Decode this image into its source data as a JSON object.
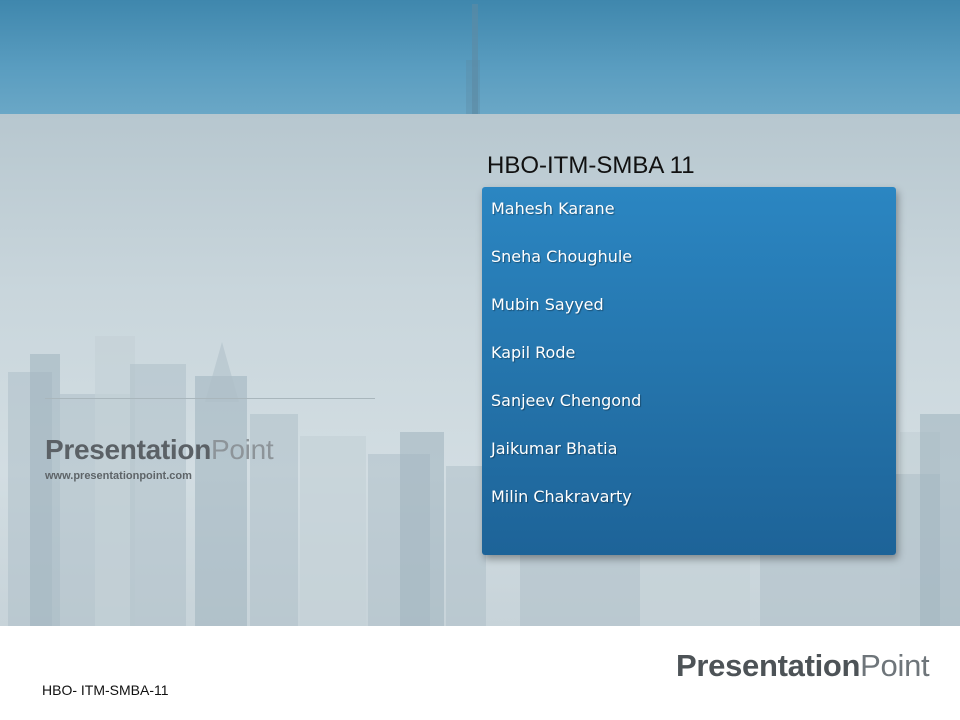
{
  "slide": {
    "heading": "HBO-ITM-SMBA 11",
    "members": [
      "Mahesh Karane",
      "Sneha Choughule",
      "Mubin Sayyed",
      "Kapil Rode",
      "Sanjeev Chengond",
      "Jaikumar Bhatia",
      "Milin Chakravarty"
    ],
    "brand": {
      "bold": "Presentation",
      "light": "Point"
    },
    "website": "www.presentationpoint.com",
    "footer": {
      "label": "HBO- ITM-SMBA-11",
      "brand_bold": "Presentation",
      "brand_light": "Point"
    }
  },
  "colors": {
    "card_blue": "#2473aa",
    "sky_blue": "#4a90b8",
    "background_grey": "#c9d6dc"
  }
}
